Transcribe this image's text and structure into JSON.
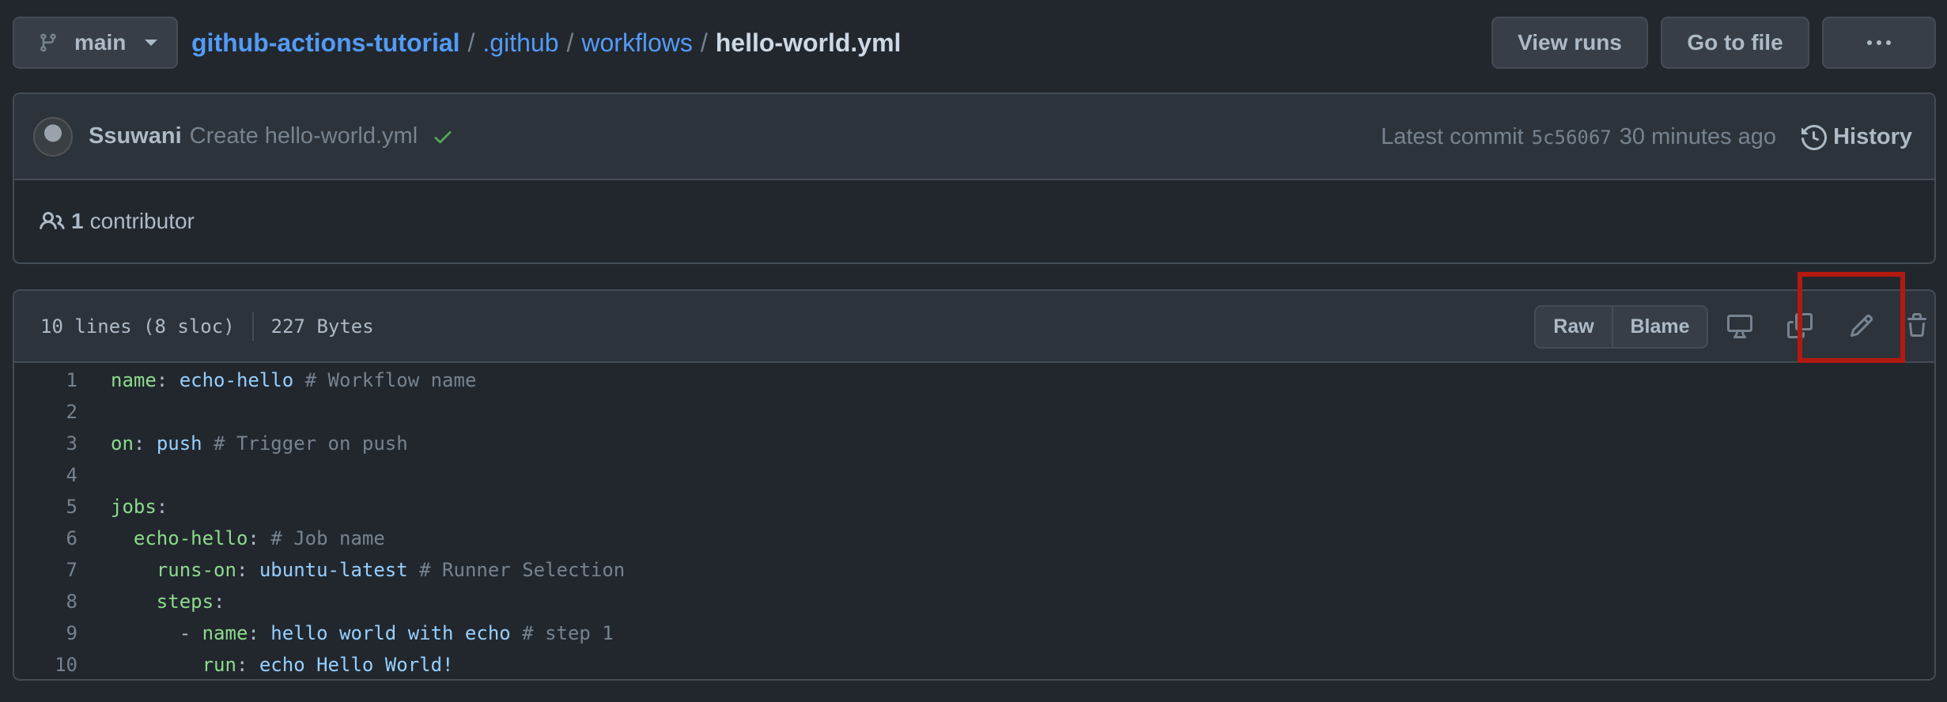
{
  "branch": {
    "name": "main"
  },
  "breadcrumb": {
    "repo": "github-actions-tutorial",
    "sep": "/",
    "dir1": ".github",
    "dir2": "workflows",
    "file": "hello-world.yml"
  },
  "top_actions": {
    "view_runs": "View runs",
    "go_to_file": "Go to file"
  },
  "commit": {
    "author": "Ssuwani",
    "message": "Create hello-world.yml",
    "latest_label": "Latest commit",
    "sha": "5c56067",
    "time": "30 minutes ago",
    "history_label": "History"
  },
  "contributors": {
    "count": "1",
    "label": "contributor"
  },
  "file": {
    "lines_info": "10 lines (8 sloc)",
    "size": "227 Bytes",
    "raw_label": "Raw",
    "blame_label": "Blame"
  },
  "code": [
    {
      "n": "1",
      "tokens": [
        [
          "k",
          "name"
        ],
        [
          "p",
          ": "
        ],
        [
          "v",
          "echo-hello"
        ],
        [
          "c",
          " # Workflow name"
        ]
      ]
    },
    {
      "n": "2",
      "tokens": []
    },
    {
      "n": "3",
      "tokens": [
        [
          "k",
          "on"
        ],
        [
          "p",
          ": "
        ],
        [
          "v",
          "push"
        ],
        [
          "c",
          " # Trigger on push"
        ]
      ]
    },
    {
      "n": "4",
      "tokens": []
    },
    {
      "n": "5",
      "tokens": [
        [
          "k",
          "jobs"
        ],
        [
          "p",
          ":"
        ]
      ]
    },
    {
      "n": "6",
      "tokens": [
        [
          "p",
          "  "
        ],
        [
          "k",
          "echo-hello"
        ],
        [
          "p",
          ":"
        ],
        [
          "c",
          " # Job name"
        ]
      ]
    },
    {
      "n": "7",
      "tokens": [
        [
          "p",
          "    "
        ],
        [
          "k",
          "runs-on"
        ],
        [
          "p",
          ": "
        ],
        [
          "v",
          "ubuntu-latest"
        ],
        [
          "c",
          " # Runner Selection"
        ]
      ]
    },
    {
      "n": "8",
      "tokens": [
        [
          "p",
          "    "
        ],
        [
          "k",
          "steps"
        ],
        [
          "p",
          ":"
        ]
      ]
    },
    {
      "n": "9",
      "tokens": [
        [
          "p",
          "      - "
        ],
        [
          "k",
          "name"
        ],
        [
          "p",
          ": "
        ],
        [
          "v",
          "hello world with echo"
        ],
        [
          "c",
          " # step 1"
        ]
      ]
    },
    {
      "n": "10",
      "tokens": [
        [
          "p",
          "        "
        ],
        [
          "k",
          "run"
        ],
        [
          "p",
          ": "
        ],
        [
          "v",
          "echo Hello World!"
        ]
      ]
    }
  ],
  "colors": {
    "bg": "#22272e",
    "link": "#539bf5",
    "highlight": "#b3190f",
    "success": "#57ab5a"
  }
}
